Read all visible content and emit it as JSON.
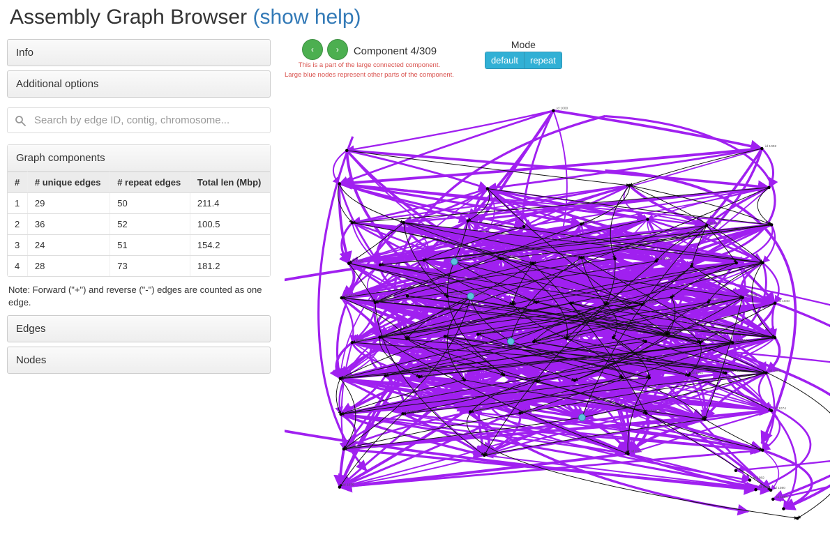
{
  "header": {
    "title": "Assembly Graph Browser",
    "help_link": "(show help)"
  },
  "panels": {
    "info": "Info",
    "additional": "Additional options",
    "edges": "Edges",
    "nodes": "Nodes"
  },
  "search": {
    "placeholder": "Search by edge ID, contig, chromosome..."
  },
  "components_table": {
    "title": "Graph components",
    "cols": [
      "#",
      "# unique edges",
      "# repeat edges",
      "Total len (Mbp)"
    ],
    "rows": [
      [
        "1",
        "29",
        "50",
        "211.4"
      ],
      [
        "2",
        "36",
        "52",
        "100.5"
      ],
      [
        "3",
        "24",
        "51",
        "154.2"
      ],
      [
        "4",
        "28",
        "73",
        "181.2"
      ]
    ],
    "note": "Note: Forward (\"+\") and reverse (\"-\") edges are counted as one edge."
  },
  "nav": {
    "prev": "‹",
    "next": "›",
    "component_label": "Component 4/309",
    "warn1": "This is a part of the large connected component.",
    "warn2": "Large blue nodes represent other parts of the component."
  },
  "mode": {
    "label": "Mode",
    "default": "default",
    "repeat": "repeat"
  },
  "colors": {
    "edge": "#a020f0",
    "edge_dark": "#111",
    "node_fill": "#000",
    "alt_part": "#5bc0de"
  }
}
